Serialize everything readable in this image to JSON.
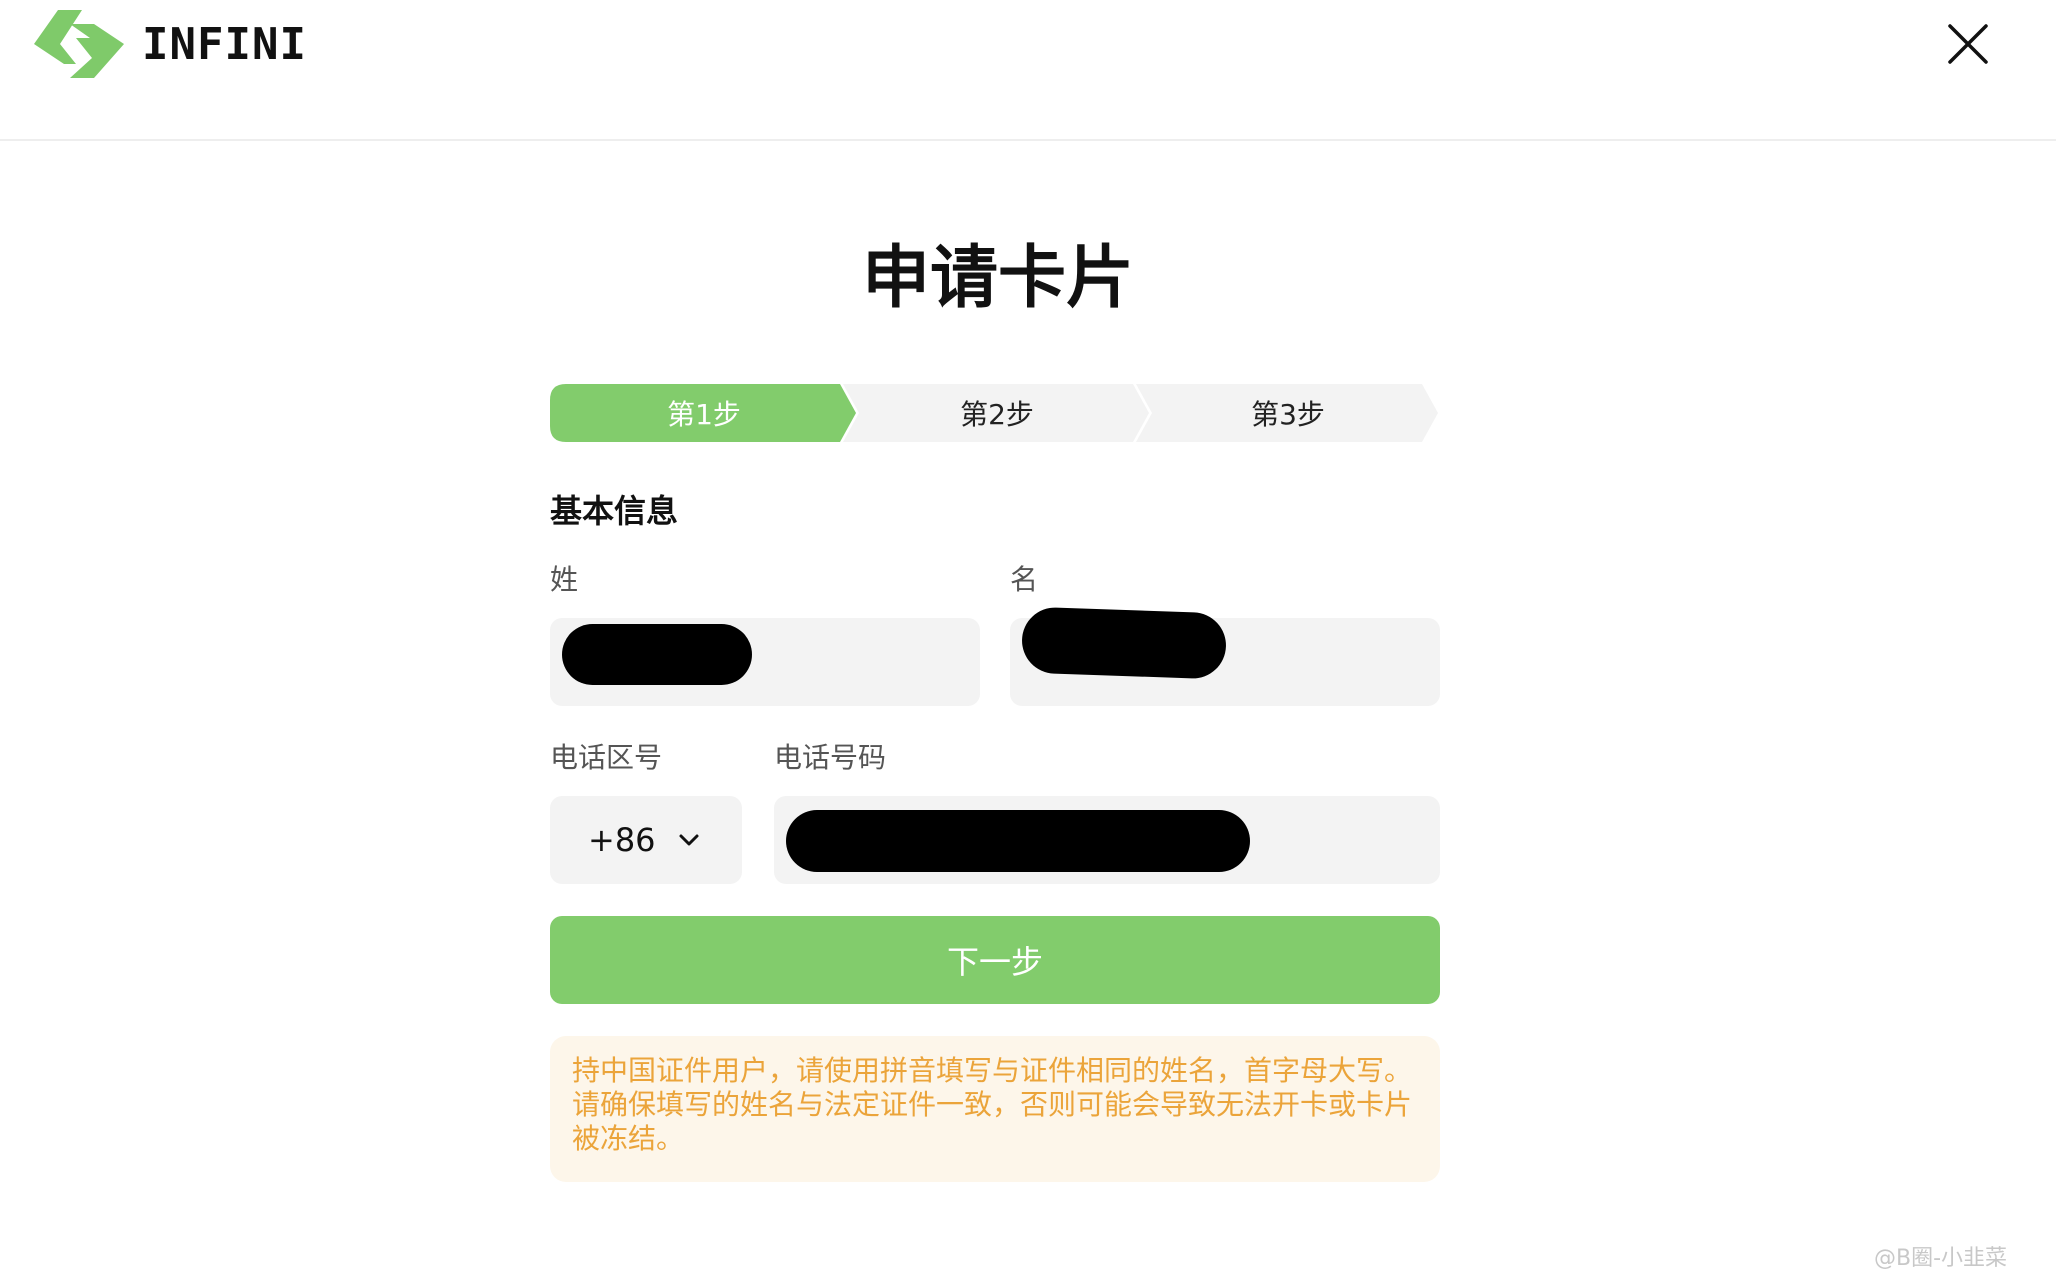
{
  "header": {
    "brand": "INFINI",
    "close_icon": "close-icon"
  },
  "title": "申请卡片",
  "steps": [
    {
      "label": "第1步",
      "active": true
    },
    {
      "label": "第2步",
      "active": false
    },
    {
      "label": "第3步",
      "active": false
    }
  ],
  "section": {
    "heading": "基本信息"
  },
  "form": {
    "last_name_label": "姓",
    "first_name_label": "名",
    "phone_code_label": "电话区号",
    "phone_number_label": "电话号码",
    "phone_code_value": "+86",
    "last_name_value": "",
    "first_name_value": "",
    "phone_number_value": ""
  },
  "next_button": "下一步",
  "notice": "持中国证件用户，请使用拼音填写与证件相同的姓名，首字母大写。请确保填写的姓名与法定证件一致，否则可能会导致无法开卡或卡片被冻结。",
  "watermark": "@B圈-小韭菜",
  "colors": {
    "accent": "#82cc6c",
    "notice_text": "#eba43a",
    "notice_bg": "#fdf6ea",
    "field_bg": "#f3f3f3"
  }
}
